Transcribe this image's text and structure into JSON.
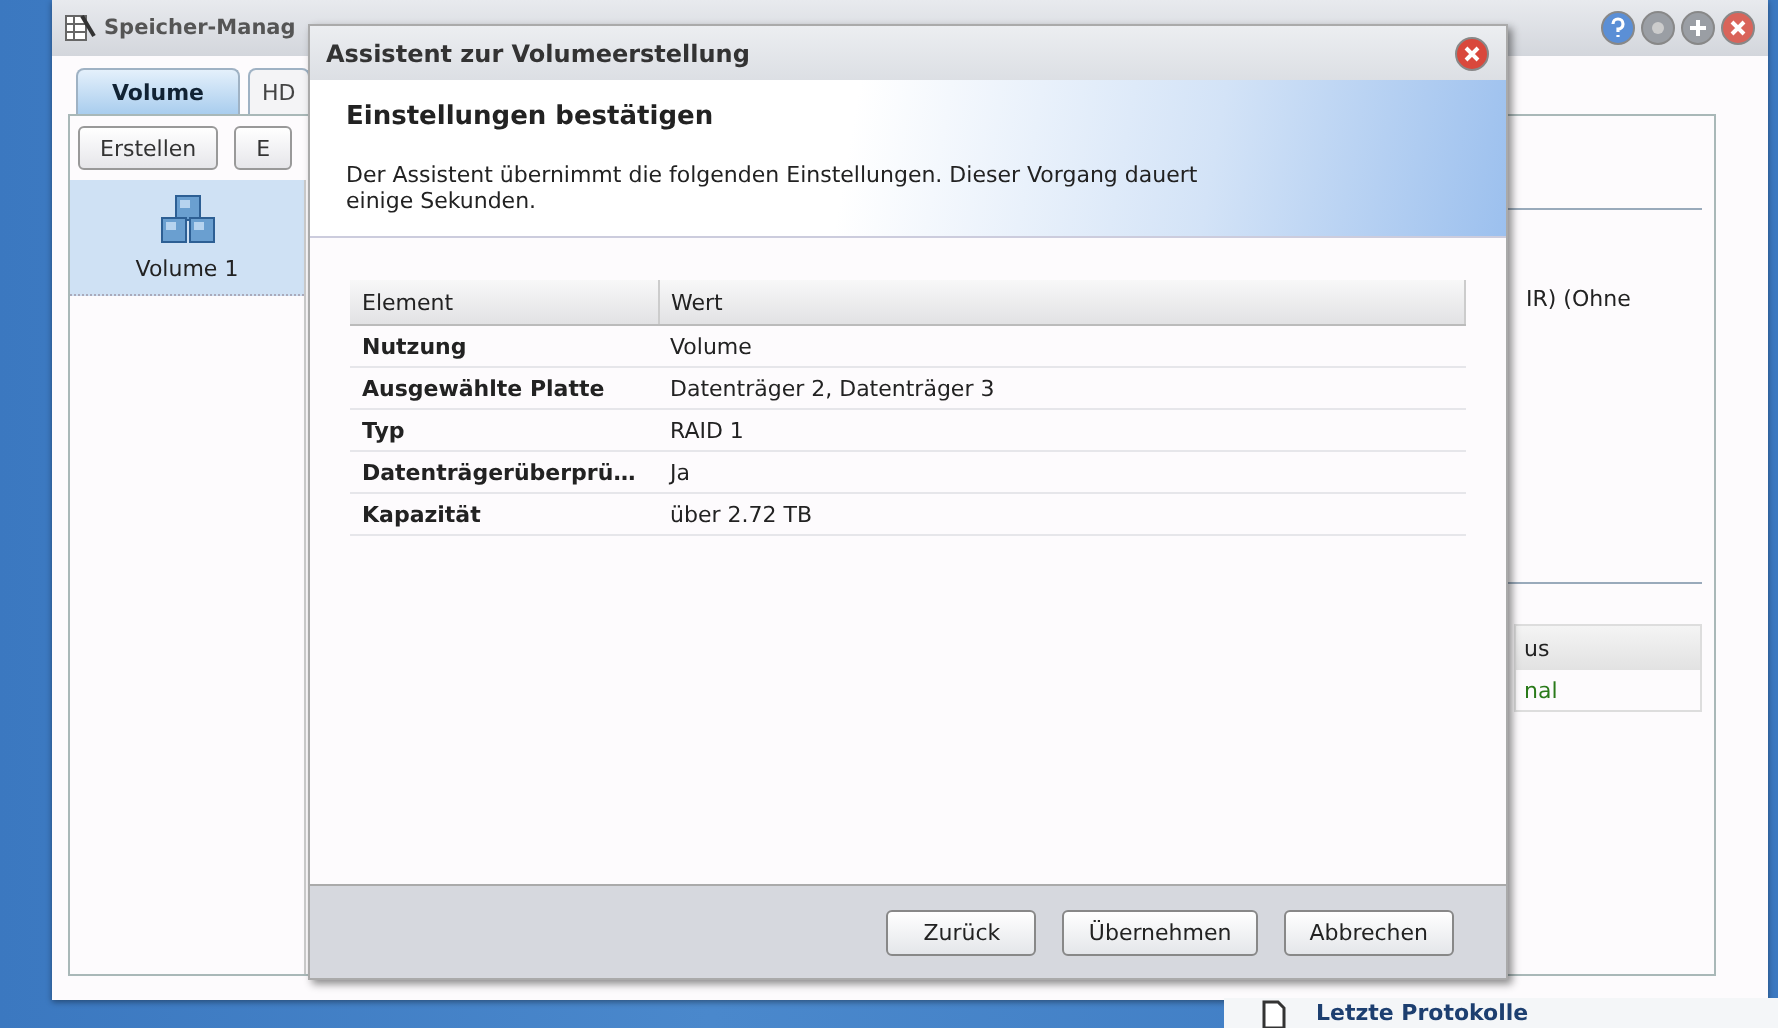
{
  "background_window": {
    "title": "Speicher-Manag",
    "tabs": [
      {
        "label": "Volume",
        "selected": true
      },
      {
        "label": "HD",
        "selected": false
      }
    ],
    "toolbar": [
      "Erstellen",
      "E"
    ],
    "volumes": [
      {
        "label": "Volume 1",
        "selected": true
      }
    ],
    "detail_text": "IR) (Ohne",
    "status_table": {
      "columns": [
        "us"
      ],
      "rows": [
        [
          "nal"
        ]
      ]
    }
  },
  "dialog": {
    "title": "Assistent zur Volumeerstellung",
    "heading": "Einstellungen bestätigen",
    "description": "Der Assistent übernimmt die folgenden Einstellungen. Dieser Vorgang dauert einige Sekunden.",
    "table": {
      "columns": [
        "Element",
        "Wert"
      ],
      "rows": [
        {
          "element": "Nutzung",
          "value": "Volume"
        },
        {
          "element": "Ausgewählte Platte",
          "value": "Datenträger 2, Datenträger 3"
        },
        {
          "element": "Typ",
          "value": "RAID 1"
        },
        {
          "element": "Datenträgerüberprü…",
          "value": "Ja"
        },
        {
          "element": "Kapazität",
          "value": "über 2.72 TB"
        }
      ]
    },
    "buttons": [
      "Zurück",
      "Übernehmen",
      "Abbrechen"
    ]
  },
  "log_panel": {
    "title": "Letzte Protokolle"
  }
}
